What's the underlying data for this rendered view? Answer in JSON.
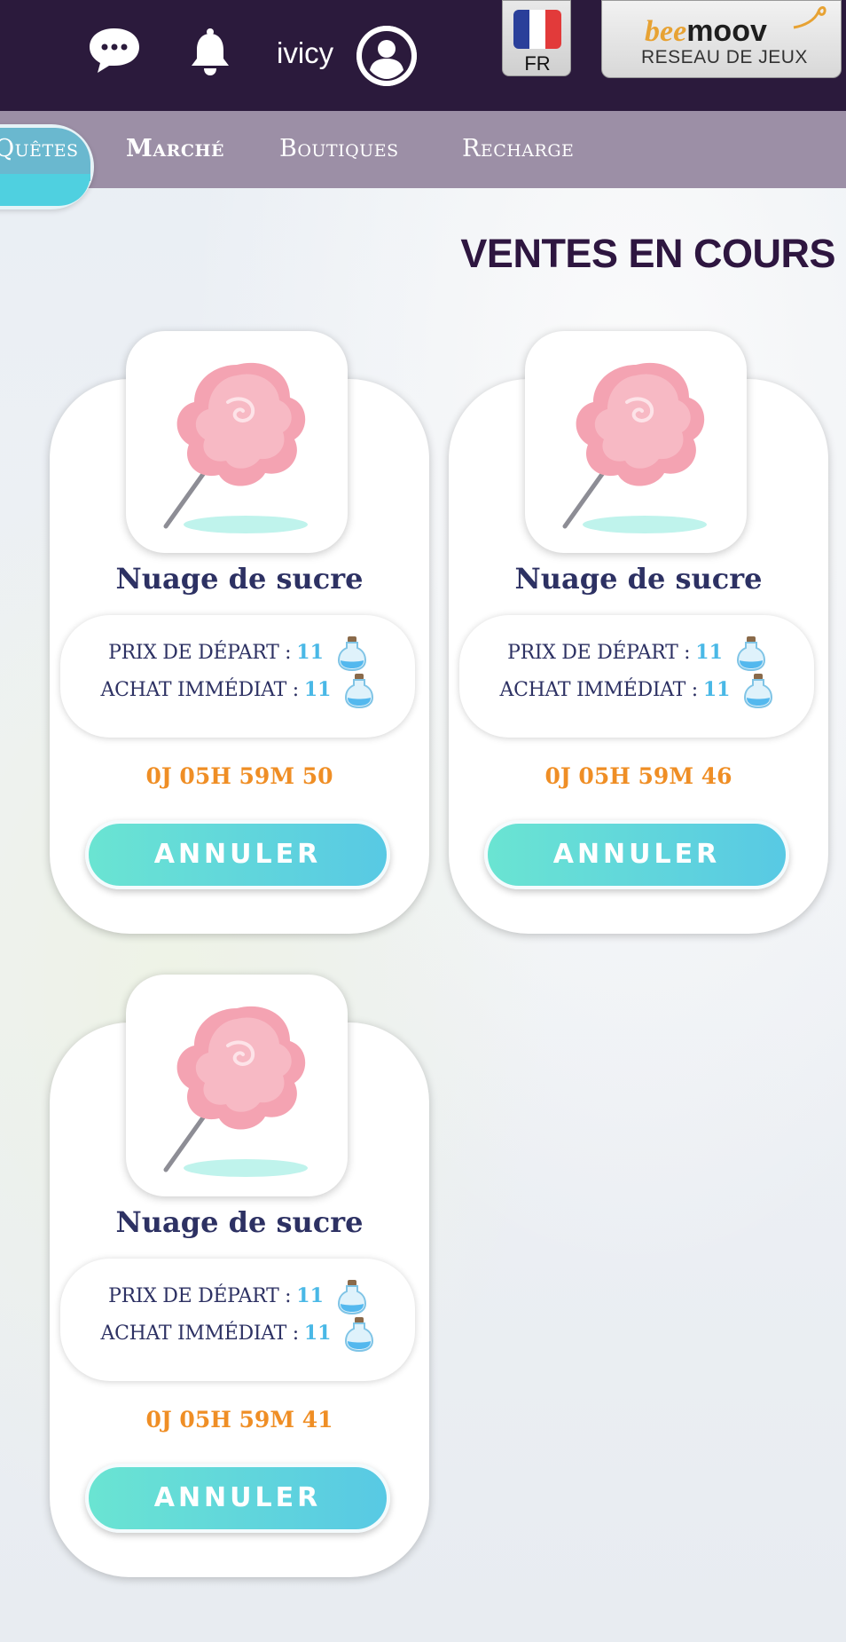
{
  "header": {
    "username": "ivicy",
    "language": "FR",
    "network_logo_part1": "bee",
    "network_logo_part2": "moov",
    "network_subtitle": "RESEAU DE JEUX"
  },
  "nav": {
    "items": [
      {
        "label": "Quêtes",
        "active": true
      },
      {
        "label": "Marché",
        "active": false
      },
      {
        "label": "Boutiques",
        "active": false
      },
      {
        "label": "Recharge",
        "active": false
      }
    ]
  },
  "page": {
    "title": "VENTES EN COURS"
  },
  "sales": [
    {
      "name": "Nuage de sucre",
      "start_price_label": "PRIX DE DÉPART :",
      "start_price": "11",
      "buy_now_label": "ACHAT IMMÉDIAT :",
      "buy_now_price": "11",
      "timer": "0J 05H 59M 50",
      "cancel_label": "ANNULER"
    },
    {
      "name": "Nuage de sucre",
      "start_price_label": "PRIX DE DÉPART :",
      "start_price": "11",
      "buy_now_label": "ACHAT IMMÉDIAT :",
      "buy_now_price": "11",
      "timer": "0J 05H 59M 46",
      "cancel_label": "ANNULER"
    },
    {
      "name": "Nuage de sucre",
      "start_price_label": "PRIX DE DÉPART :",
      "start_price": "11",
      "buy_now_label": "ACHAT IMMÉDIAT :",
      "buy_now_price": "11",
      "timer": "0J 05H 59M 41",
      "cancel_label": "ANNULER"
    }
  ],
  "icons": {
    "chat": "chat-bubble-icon",
    "bell": "bell-icon",
    "avatar": "user-avatar-icon",
    "currency": "potion-bottle-icon",
    "item": "cotton-candy-icon"
  },
  "colors": {
    "topbar": "#2b1a3c",
    "navbar": "#9c8fa6",
    "title": "#2e1640",
    "item_name": "#2d3163",
    "price_value": "#49b8e6",
    "timer": "#ef8e25",
    "button_gradient_start": "#6ae4d2",
    "button_gradient_end": "#58c9e4"
  }
}
